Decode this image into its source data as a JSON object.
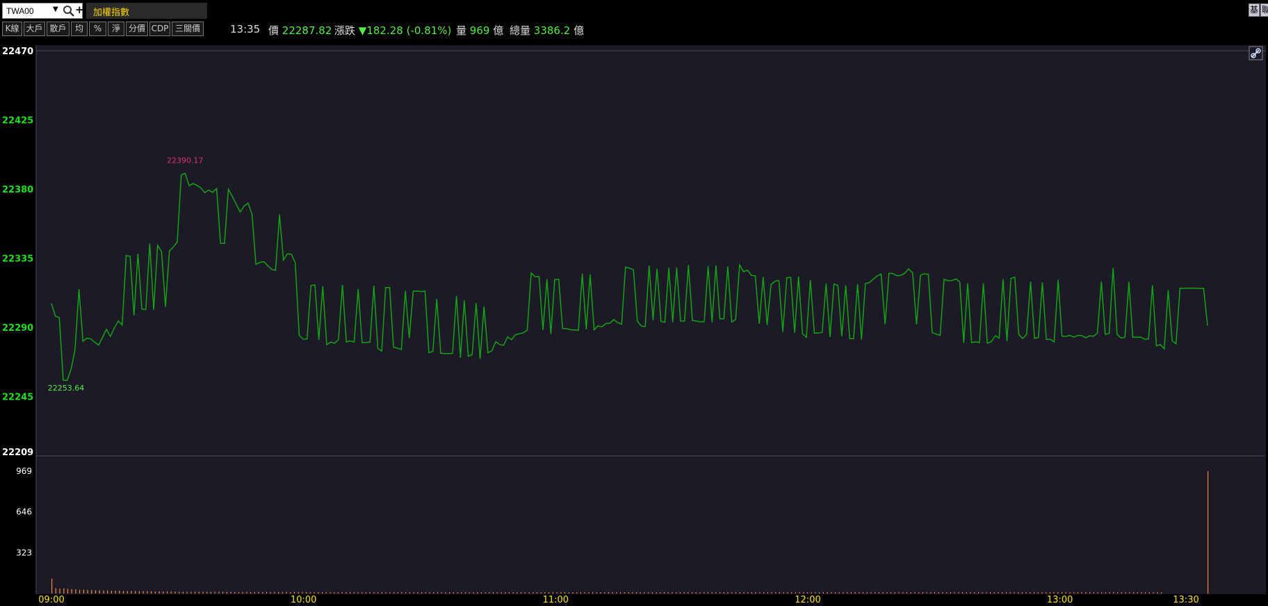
{
  "symbol": {
    "code": "TWA00"
  },
  "index_name": "加權指數",
  "right_buttons": [
    "基",
    "聯"
  ],
  "toolbar": {
    "buttons": [
      "K線",
      "大戶",
      "散戶",
      "均",
      "%",
      "淨",
      "分價",
      "CDP",
      "三關價"
    ]
  },
  "quote": {
    "time": "13:35",
    "price_label": "價",
    "price": "22287.82",
    "change_label": "漲跌",
    "change_arrow": "▼",
    "change": "182.28",
    "change_pct": "(-0.81%)",
    "volume_label": "量",
    "volume": "969",
    "volume_unit": "億",
    "total_volume_label": "總量",
    "total_volume": "3386.2",
    "total_volume_unit": "億"
  },
  "colors": {
    "background": "#1b1a26",
    "line": "#12a412",
    "axis_label": "#22dd22",
    "volume_bar": "#ff8c3a",
    "time_label": "#ffe600",
    "high_label": "#e0307a",
    "low_label": "#55ee44"
  },
  "chart_data": {
    "type": "line",
    "price_axis": {
      "ticks": [
        "22470",
        "22425",
        "22380",
        "22335",
        "22290",
        "22245",
        "22209"
      ],
      "ylim": [
        22209,
        22470
      ]
    },
    "volume_axis": {
      "ticks": [
        "969",
        "646",
        "323"
      ],
      "ylim": [
        0,
        969
      ]
    },
    "time_axis": {
      "ticks": [
        "09:00",
        "10:00",
        "11:00",
        "12:00",
        "13:00",
        "13:30"
      ]
    },
    "annotations": {
      "high": "22390.17",
      "low": "22253.64"
    },
    "series": [
      {
        "values": [
          22305.5,
          22297.2,
          22296.3,
          22255.5,
          22255.5,
          22262.8,
          22275.4,
          22314.9,
          22280.9,
          22282.9,
          22282.4,
          22280.3,
          22278.4,
          22283.4,
          22288.7,
          22284.0,
          22289.6,
          22294.1,
          22291.5,
          22336.7,
          22336.3,
          22297.8,
          22337.9,
          22301.9,
          22301.5,
          22344.5,
          22301.4,
          22343.4,
          22339.2,
          22303.4,
          22339.7,
          22342.3,
          22345.6,
          22389.1,
          22390.2,
          22382.2,
          22383.5,
          22382.4,
          22380.7,
          22377.6,
          22379.3,
          22377.8,
          22380.3,
          22344.7,
          22344.6,
          22379.9,
          22375.2,
          22370.0,
          22365.1,
          22368.9,
          22370.8,
          22363.6,
          22331.0,
          22332.2,
          22332.7,
          22330.1,
          22327.7,
          22327.1,
          22363.4,
          22333.8,
          22337.8,
          22337.6,
          22332.1,
          22284.8,
          22282.3,
          22282.4,
          22317.2,
          22317.5,
          22281.8,
          22316.7,
          22278.6,
          22280.4,
          22279.6,
          22282.0,
          22317.5,
          22280.5,
          22281.1,
          22280.4,
          22315.0,
          22280.0,
          22280.1,
          22280.3,
          22317.0,
          22276.3,
          22274.5,
          22315.9,
          22315.9,
          22276.9,
          22276.5,
          22275.5,
          22313.7,
          22283.0,
          22313.5,
          22313.6,
          22313.2,
          22313.5,
          22273.4,
          22274.3,
          22308.4,
          22273.1,
          22272.9,
          22272.9,
          22273.0,
          22310.4,
          22270.0,
          22307.5,
          22271.1,
          22272.2,
          22305.8,
          22269.4,
          22303.5,
          22273.4,
          22274.6,
          22280.6,
          22278.8,
          22278.3,
          22283.8,
          22281.9,
          22285.2,
          22285.7,
          22286.4,
          22288.1,
          22325.3,
          22322.9,
          22323.0,
          22288.3,
          22321.4,
          22285.6,
          22321.1,
          22321.2,
          22289.1,
          22289.2,
          22288.4,
          22288.3,
          22288.0,
          22324.9,
          22288.7,
          22324.4,
          22288.4,
          22290.9,
          22290.3,
          22292.5,
          22292.6,
          22295.0,
          22293.0,
          22292.0,
          22329.2,
          22328.5,
          22327.4,
          22294.1,
          22290.8,
          22290.4,
          22330.1,
          22294.6,
          22328.1,
          22293.8,
          22293.3,
          22328.7,
          22293.3,
          22328.9,
          22294.1,
          22294.0,
          22330.5,
          22294.4,
          22294.1,
          22293.5,
          22293.7,
          22329.8,
          22293.3,
          22330.3,
          22295.5,
          22295.6,
          22329.6,
          22293.4,
          22295.1,
          22330.7,
          22326.2,
          22327.2,
          22323.8,
          22323.5,
          22292.3,
          22322.8,
          22291.5,
          22317.8,
          22319.9,
          22320.5,
          22287.0,
          22322.2,
          22322.5,
          22286.4,
          22323.1,
          22285.8,
          22283.4,
          22320.8,
          22286.2,
          22286.2,
          22286.7,
          22318.4,
          22283.7,
          22318.2,
          22317.2,
          22284.2,
          22317.3,
          22282.6,
          22282.5,
          22318.2,
          22282.1,
          22318.5,
          22319.0,
          22321.3,
          22323.5,
          22324.6,
          22292.0,
          22325.1,
          22325.0,
          22323.5,
          22323.8,
          22325.1,
          22328.0,
          22325.4,
          22291.8,
          22323.8,
          22324.9,
          22324.3,
          22286.5,
          22285.6,
          22284.7,
          22321.2,
          22320.4,
          22320.3,
          22321.5,
          22319.6,
          22279.9,
          22318.7,
          22280.0,
          22280.5,
          22280.0,
          22318.6,
          22279.7,
          22280.5,
          22284.5,
          22283.0,
          22321.3,
          22280.9,
          22321.9,
          22322.6,
          22285.3,
          22282.7,
          22285.4,
          22319.7,
          22282.8,
          22283.4,
          22319.2,
          22282.2,
          22282.2,
          22280.6,
          22321.0,
          22284.2,
          22284.1,
          22284.7,
          22283.6,
          22284.7,
          22284.6,
          22283.2,
          22284.4,
          22284.2,
          22286.2,
          22319.7,
          22285.3,
          22286.1,
          22328.7,
          22285.4,
          22283.0,
          22283.5,
          22319.5,
          22283.5,
          22283.5,
          22283.5,
          22282.3,
          22282.4,
          22317.4,
          22277.9,
          22278.8,
          22276.0,
          22314.2,
          22281.3,
          22279.2,
          22315.5,
          22315.4,
          22315.5,
          22315.5,
          22315.5,
          22315.3,
          22315.4,
          22291.1
        ]
      },
      {
        "name": "volume",
        "values": [
          118,
          42,
          38,
          40,
          36,
          34,
          34,
          30,
          30,
          28,
          28,
          26,
          26,
          24,
          24,
          22,
          22,
          22,
          20,
          20,
          20,
          20,
          18,
          18,
          18,
          18,
          16,
          16,
          16,
          16,
          16,
          16,
          14,
          14,
          14,
          14,
          14,
          14,
          14,
          14,
          14,
          14,
          14,
          14,
          12,
          12,
          12,
          12,
          12,
          12,
          12,
          12,
          12,
          12,
          12,
          12,
          12,
          12,
          12,
          12,
          12,
          12,
          12,
          12,
          12,
          12,
          10,
          10,
          10,
          10,
          10,
          10,
          10,
          10,
          10,
          10,
          10,
          10,
          10,
          10,
          10,
          10,
          10,
          10,
          10,
          10,
          10,
          10,
          10,
          10,
          10,
          10,
          10,
          10,
          10,
          10,
          10,
          10,
          10,
          10,
          10,
          10,
          10,
          10,
          10,
          10,
          10,
          10,
          10,
          10,
          10,
          10,
          10,
          10,
          10,
          10,
          10,
          10,
          10,
          10,
          10,
          10,
          10,
          10,
          10,
          10,
          10,
          10,
          10,
          10,
          10,
          10,
          10,
          10,
          10,
          10,
          10,
          10,
          10,
          10,
          10,
          10,
          10,
          10,
          10,
          10,
          10,
          10,
          10,
          10,
          10,
          10,
          10,
          10,
          10,
          10,
          10,
          10,
          10,
          10,
          10,
          10,
          10,
          10,
          10,
          10,
          10,
          10,
          10,
          10,
          10,
          10,
          10,
          10,
          10,
          10,
          10,
          10,
          10,
          10,
          10,
          10,
          10,
          10,
          10,
          10,
          10,
          10,
          10,
          10,
          10,
          10,
          10,
          10,
          10,
          10,
          10,
          10,
          10,
          10,
          10,
          10,
          10,
          10,
          10,
          10,
          10,
          10,
          10,
          10,
          10,
          10,
          10,
          10,
          10,
          10,
          10,
          10,
          10,
          10,
          10,
          10,
          10,
          10,
          10,
          10,
          10,
          10,
          10,
          10,
          10,
          10,
          10,
          10,
          10,
          10,
          10,
          10,
          10,
          10,
          10,
          10,
          10,
          10,
          10,
          10,
          10,
          10,
          10,
          10,
          10,
          10,
          10,
          10,
          10,
          10,
          10,
          10,
          10,
          10,
          10,
          10,
          10,
          10,
          10,
          10,
          10,
          10,
          10,
          10,
          10,
          10,
          10,
          10,
          10,
          10,
          10,
          10,
          10,
          10,
          969
        ]
      }
    ]
  }
}
